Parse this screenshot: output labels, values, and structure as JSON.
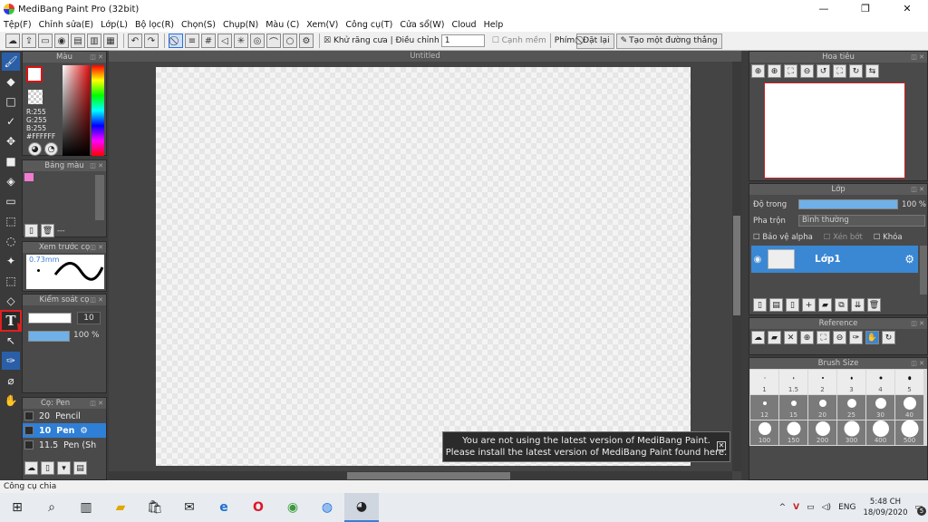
{
  "window": {
    "title": "MediBang Paint Pro (32bit)",
    "min": "—",
    "max": "❐",
    "close": "✕"
  },
  "menu": [
    "Tệp(F)",
    "Chỉnh sửa(E)",
    "Lớp(L)",
    "Bộ lọc(R)",
    "Chọn(S)",
    "Chụp(N)",
    "Màu (C)",
    "Xem(V)",
    "Công cụ(T)",
    "Cửa sổ(W)",
    "Cloud",
    "Help"
  ],
  "toolbar": {
    "antialias_label": "Khử răng cưa",
    "adjust_label": "Điều chỉnh",
    "adjust_value": "1",
    "soft_edge_label": "Cạnh mềm",
    "key_label": "Phím",
    "reset_label": "Đặt lại",
    "straight_line_label": "Tạo một đường thẳng"
  },
  "color_panel": {
    "title": "Màu",
    "r": "R:255",
    "g": "G:255",
    "b": "B:255",
    "hex": "#FFFFFF"
  },
  "palette_panel": {
    "title": "Bảng màu",
    "dash": "---"
  },
  "brush_preview": {
    "title": "Xem trước cọ",
    "size": "0.73mm"
  },
  "brush_control": {
    "title": "Kiểm soát cọ",
    "size_value": "10",
    "opacity_value": "100 %"
  },
  "brush_list": {
    "title": "Cọ: Pen",
    "items": [
      {
        "size": "20",
        "name": "Pencil"
      },
      {
        "size": "10",
        "name": "Pen"
      },
      {
        "size": "11.5",
        "name": "Pen (Sh"
      }
    ]
  },
  "canvas": {
    "tab": "Untitled"
  },
  "notice": {
    "line1": "You are not using the latest version of MediBang Paint.",
    "line2": "Please install the latest version of MediBang Paint found here."
  },
  "navigator": {
    "title": "Hoa tiêu"
  },
  "layer_panel": {
    "title": "Lớp",
    "opacity_label": "Độ trong",
    "opacity_value": "100 %",
    "blend_label": "Pha trộn",
    "blend_value": "Bình thường",
    "protect_alpha": "Bảo vệ alpha",
    "clipping": "Xén bớt",
    "lock": "Khóa",
    "layer_name": "Lớp1"
  },
  "reference": {
    "title": "Reference"
  },
  "brush_size": {
    "title": "Brush Size",
    "sizes": [
      "1",
      "1.5",
      "2",
      "3",
      "4",
      "5",
      "12",
      "15",
      "20",
      "25",
      "30",
      "40",
      "100",
      "150",
      "200",
      "300",
      "400",
      "500"
    ]
  },
  "status": {
    "text": "Công cụ chia"
  },
  "taskbar": {
    "lang": "ENG",
    "time": "5:48 CH",
    "date": "18/09/2020",
    "notif": "5"
  }
}
